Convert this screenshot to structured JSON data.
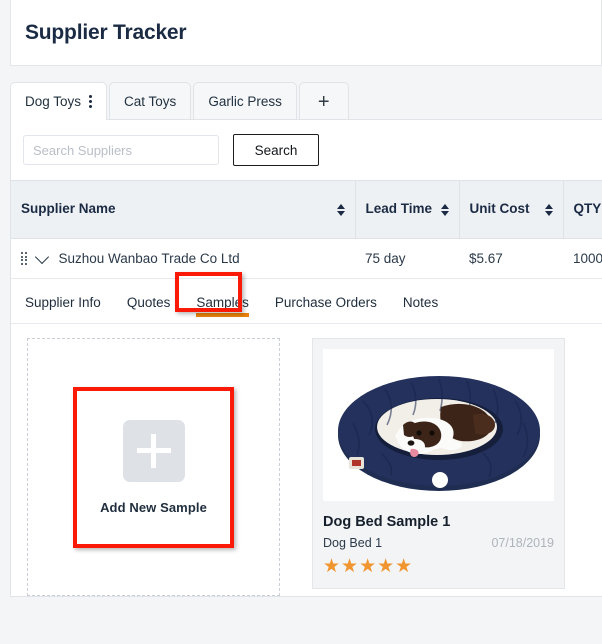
{
  "header": {
    "title": "Supplier Tracker"
  },
  "top_tabs": {
    "items": [
      {
        "label": "Dog Toys",
        "active": true,
        "has_kebab": true
      },
      {
        "label": "Cat Toys",
        "active": false,
        "has_kebab": false
      },
      {
        "label": "Garlic Press",
        "active": false,
        "has_kebab": false
      }
    ],
    "add_tab_icon": "plus-icon",
    "add_tab_glyph": "+"
  },
  "search": {
    "placeholder": "Search Suppliers",
    "value": "",
    "button_label": "Search"
  },
  "table": {
    "columns": [
      {
        "label": "Supplier Name",
        "sortable": true
      },
      {
        "label": "Lead Time",
        "sortable": true
      },
      {
        "label": "Unit Cost",
        "sortable": true
      },
      {
        "label": "QTY",
        "sortable": false
      }
    ],
    "rows": [
      {
        "supplier_name": "Suzhou Wanbao Trade Co Ltd",
        "lead_time": "75 day",
        "unit_cost": "$5.67",
        "qty": "1000"
      }
    ]
  },
  "sub_tabs": {
    "items": [
      {
        "label": "Supplier Info",
        "active": false
      },
      {
        "label": "Quotes",
        "active": false
      },
      {
        "label": "Samples",
        "active": true
      },
      {
        "label": "Purchase Orders",
        "active": false
      },
      {
        "label": "Notes",
        "active": false
      }
    ],
    "active_underline_color": "#e8820c"
  },
  "samples": {
    "add_card": {
      "label": "Add New Sample",
      "icon": "plus-icon"
    },
    "cards": [
      {
        "title": "Dog Bed Sample 1",
        "subtitle": "Dog Bed 1",
        "date": "07/18/2019",
        "rating": 5,
        "stars_glyph": "★★★★★",
        "image_alt": "navy-blue-donut-dog-bed-with-dog"
      }
    ]
  },
  "annotations": {
    "highlight_color": "#fb1a08",
    "targets": [
      "sub-tab-samples",
      "add-new-sample-card"
    ]
  }
}
